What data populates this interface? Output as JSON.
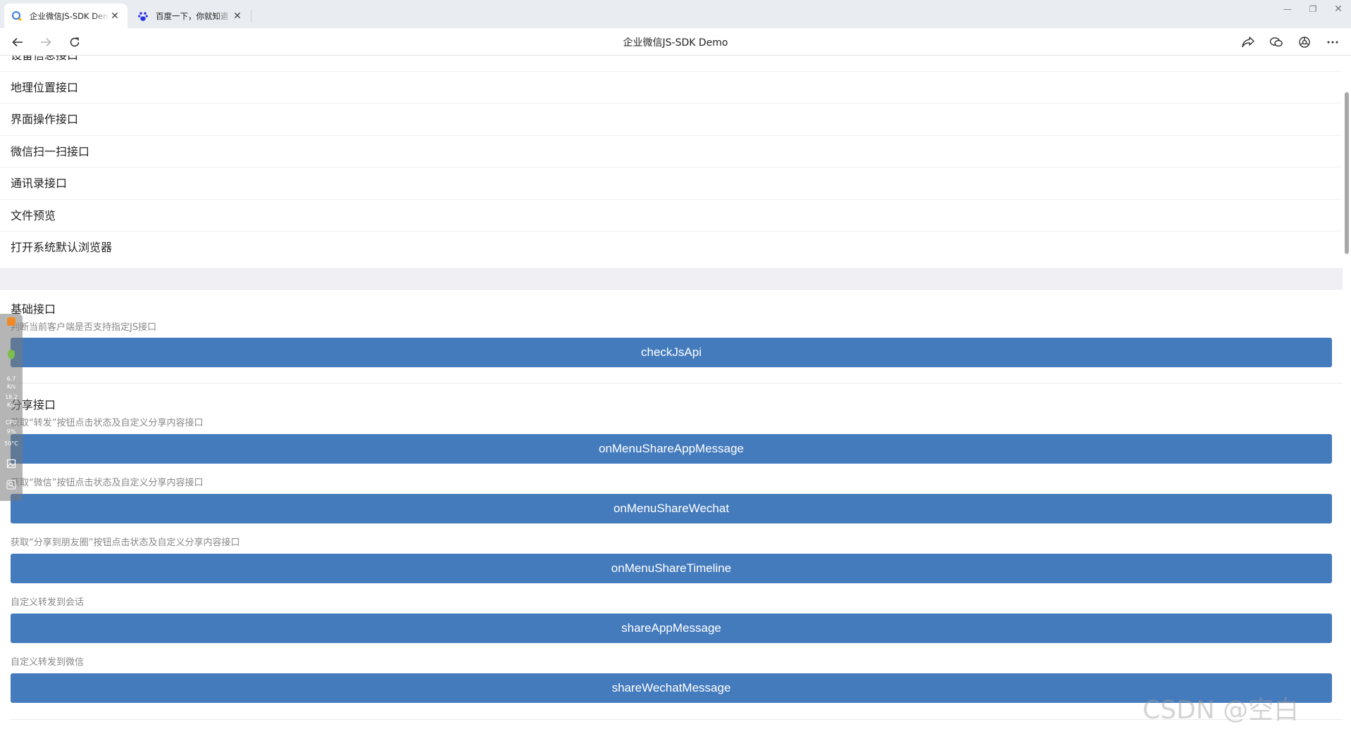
{
  "browser": {
    "tabs": [
      {
        "title": "企业微信JS-SDK Demo",
        "favicon": "wecom-icon",
        "active": true
      },
      {
        "title": "百度一下，你就知道",
        "favicon": "baidu-paw-icon",
        "active": false
      }
    ],
    "page_title": "企业微信JS-SDK Demo",
    "toolbar_icons": [
      "share-icon",
      "chat-icon",
      "extension-icon",
      "more-icon"
    ]
  },
  "menu": {
    "items": [
      "设备信息接口",
      "地理位置接口",
      "界面操作接口",
      "微信扫一扫接口",
      "通讯录接口",
      "文件预览",
      "打开系统默认浏览器"
    ]
  },
  "sections": {
    "basic": {
      "title": "基础接口",
      "apis": [
        {
          "desc": "判断当前客户端是否支持指定JS接口",
          "button": "checkJsApi"
        }
      ]
    },
    "share": {
      "title": "分享接口",
      "apis": [
        {
          "desc": "获取“转发”按钮点击状态及自定义分享内容接口",
          "button": "onMenuShareAppMessage"
        },
        {
          "desc": "获取“微信”按钮点击状态及自定义分享内容接口",
          "button": "onMenuShareWechat"
        },
        {
          "desc": "获取“分享到朋友圈”按钮点击状态及自定义分享内容接口",
          "button": "onMenuShareTimeline"
        },
        {
          "desc": "自定义转发到会话",
          "button": "shareAppMessage"
        },
        {
          "desc": "自定义转发到微信",
          "button": "shareWechatMessage"
        }
      ]
    }
  },
  "widget": {
    "items": [
      "6.7",
      "K/s",
      "18.2",
      "K/s",
      "CPU",
      "9%",
      "50°C"
    ]
  },
  "watermark": "CSDN @空白",
  "colors": {
    "button": "#447bbd",
    "gap": "#efeff4"
  }
}
